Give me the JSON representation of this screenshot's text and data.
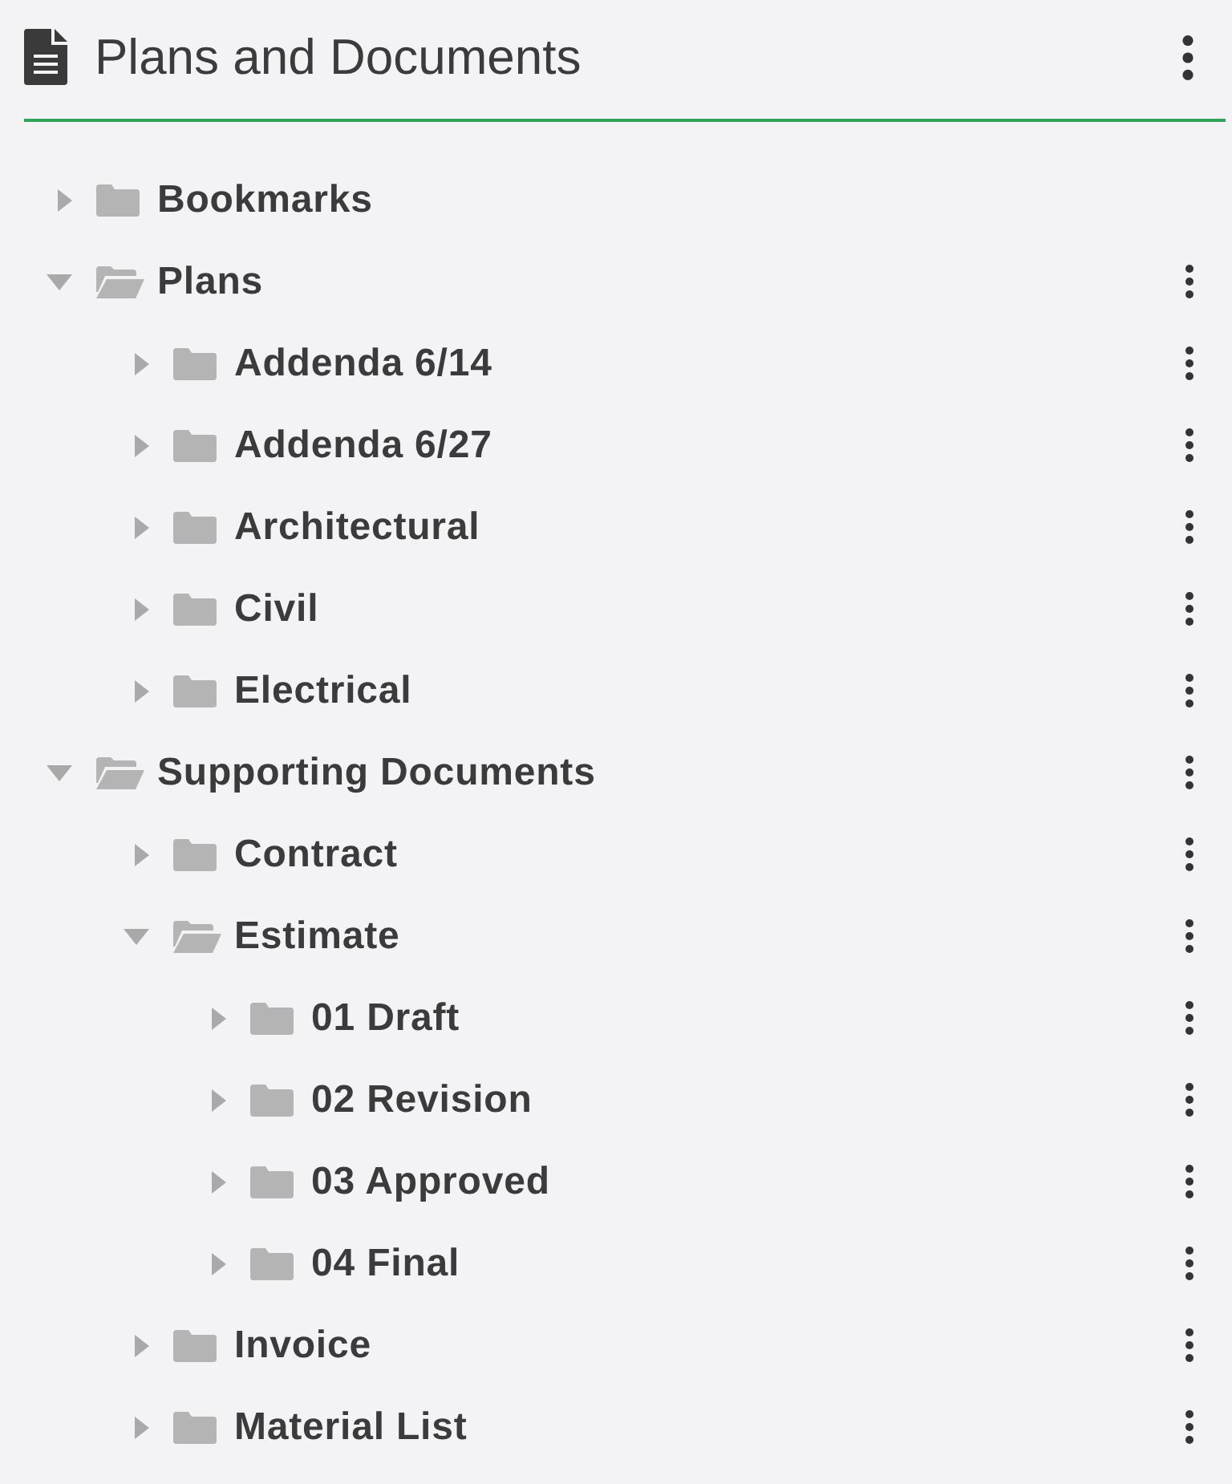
{
  "header": {
    "title": "Plans and Documents"
  },
  "tree": [
    {
      "label": "Bookmarks",
      "expanded": false,
      "has_menu": false
    },
    {
      "label": "Plans",
      "expanded": true,
      "has_menu": true,
      "children": [
        {
          "label": "Addenda 6/14",
          "expanded": false,
          "has_menu": true
        },
        {
          "label": "Addenda 6/27",
          "expanded": false,
          "has_menu": true
        },
        {
          "label": "Architectural",
          "expanded": false,
          "has_menu": true
        },
        {
          "label": "Civil",
          "expanded": false,
          "has_menu": true
        },
        {
          "label": "Electrical",
          "expanded": false,
          "has_menu": true
        }
      ]
    },
    {
      "label": "Supporting Documents",
      "expanded": true,
      "has_menu": true,
      "children": [
        {
          "label": "Contract",
          "expanded": false,
          "has_menu": true
        },
        {
          "label": "Estimate",
          "expanded": true,
          "has_menu": true,
          "children": [
            {
              "label": "01 Draft",
              "expanded": false,
              "has_menu": true
            },
            {
              "label": "02 Revision",
              "expanded": false,
              "has_menu": true
            },
            {
              "label": "03 Approved",
              "expanded": false,
              "has_menu": true
            },
            {
              "label": "04 Final",
              "expanded": false,
              "has_menu": true
            }
          ]
        },
        {
          "label": "Invoice",
          "expanded": false,
          "has_menu": true
        },
        {
          "label": "Material List",
          "expanded": false,
          "has_menu": true
        }
      ]
    }
  ]
}
